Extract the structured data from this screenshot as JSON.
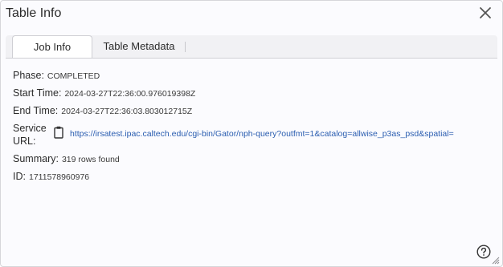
{
  "dialog": {
    "title": "Table Info"
  },
  "tabs": [
    {
      "label": "Job Info",
      "active": true
    },
    {
      "label": "Table Metadata",
      "active": false
    }
  ],
  "job_info": {
    "phase_label": "Phase:",
    "phase_value": "COMPLETED",
    "start_label": "Start Time:",
    "start_value": "2024-03-27T22:36:00.976019398Z",
    "end_label": "End Time:",
    "end_value": "2024-03-27T22:36:03.803012715Z",
    "service_label_line1": "Service",
    "service_label_line2": "URL:",
    "service_url": "https://irsatest.ipac.caltech.edu/cgi-bin/Gator/nph-query?outfmt=1&catalog=allwise_p3as_psd&spatial=",
    "summary_label": "Summary:",
    "summary_value": "319 rows found",
    "id_label": "ID:",
    "id_value": "1711578960976"
  },
  "icons": {
    "close": "close-icon",
    "clipboard": "clipboard-icon",
    "help": "help-icon",
    "resize": "resize-grip-icon"
  }
}
